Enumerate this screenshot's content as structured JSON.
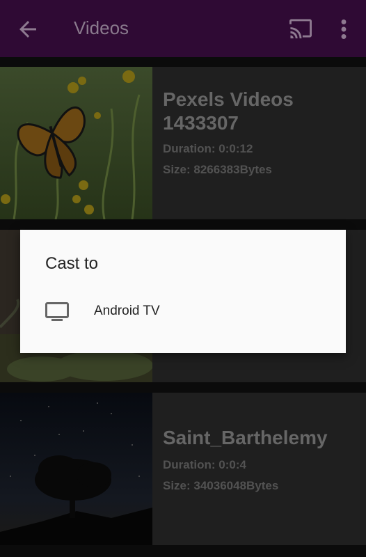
{
  "appbar": {
    "title": "Videos",
    "back_icon": "arrow-left-icon",
    "cast_icon": "cast-icon",
    "more_icon": "more-vert-icon",
    "background": "#2f0a34"
  },
  "videos": [
    {
      "title_line1": "Pexels Videos",
      "title_line2": "1433307",
      "duration": "Duration:  0:0:12",
      "size": "Size:  8266383Bytes",
      "thumbnail": "butterfly-on-flowers"
    },
    {
      "title_line1": "",
      "title_line2": "",
      "duration": "",
      "size": "",
      "thumbnail": "bird-on-branch"
    },
    {
      "title_line1": "Saint_Barthelemy",
      "title_line2": "",
      "duration": "Duration:  0:0:4",
      "size": "Size:  34036048Bytes",
      "thumbnail": "night-sky-tree"
    }
  ],
  "cast_dialog": {
    "title": "Cast to",
    "routes": [
      {
        "label": "Android TV",
        "icon": "tv-icon"
      }
    ]
  }
}
